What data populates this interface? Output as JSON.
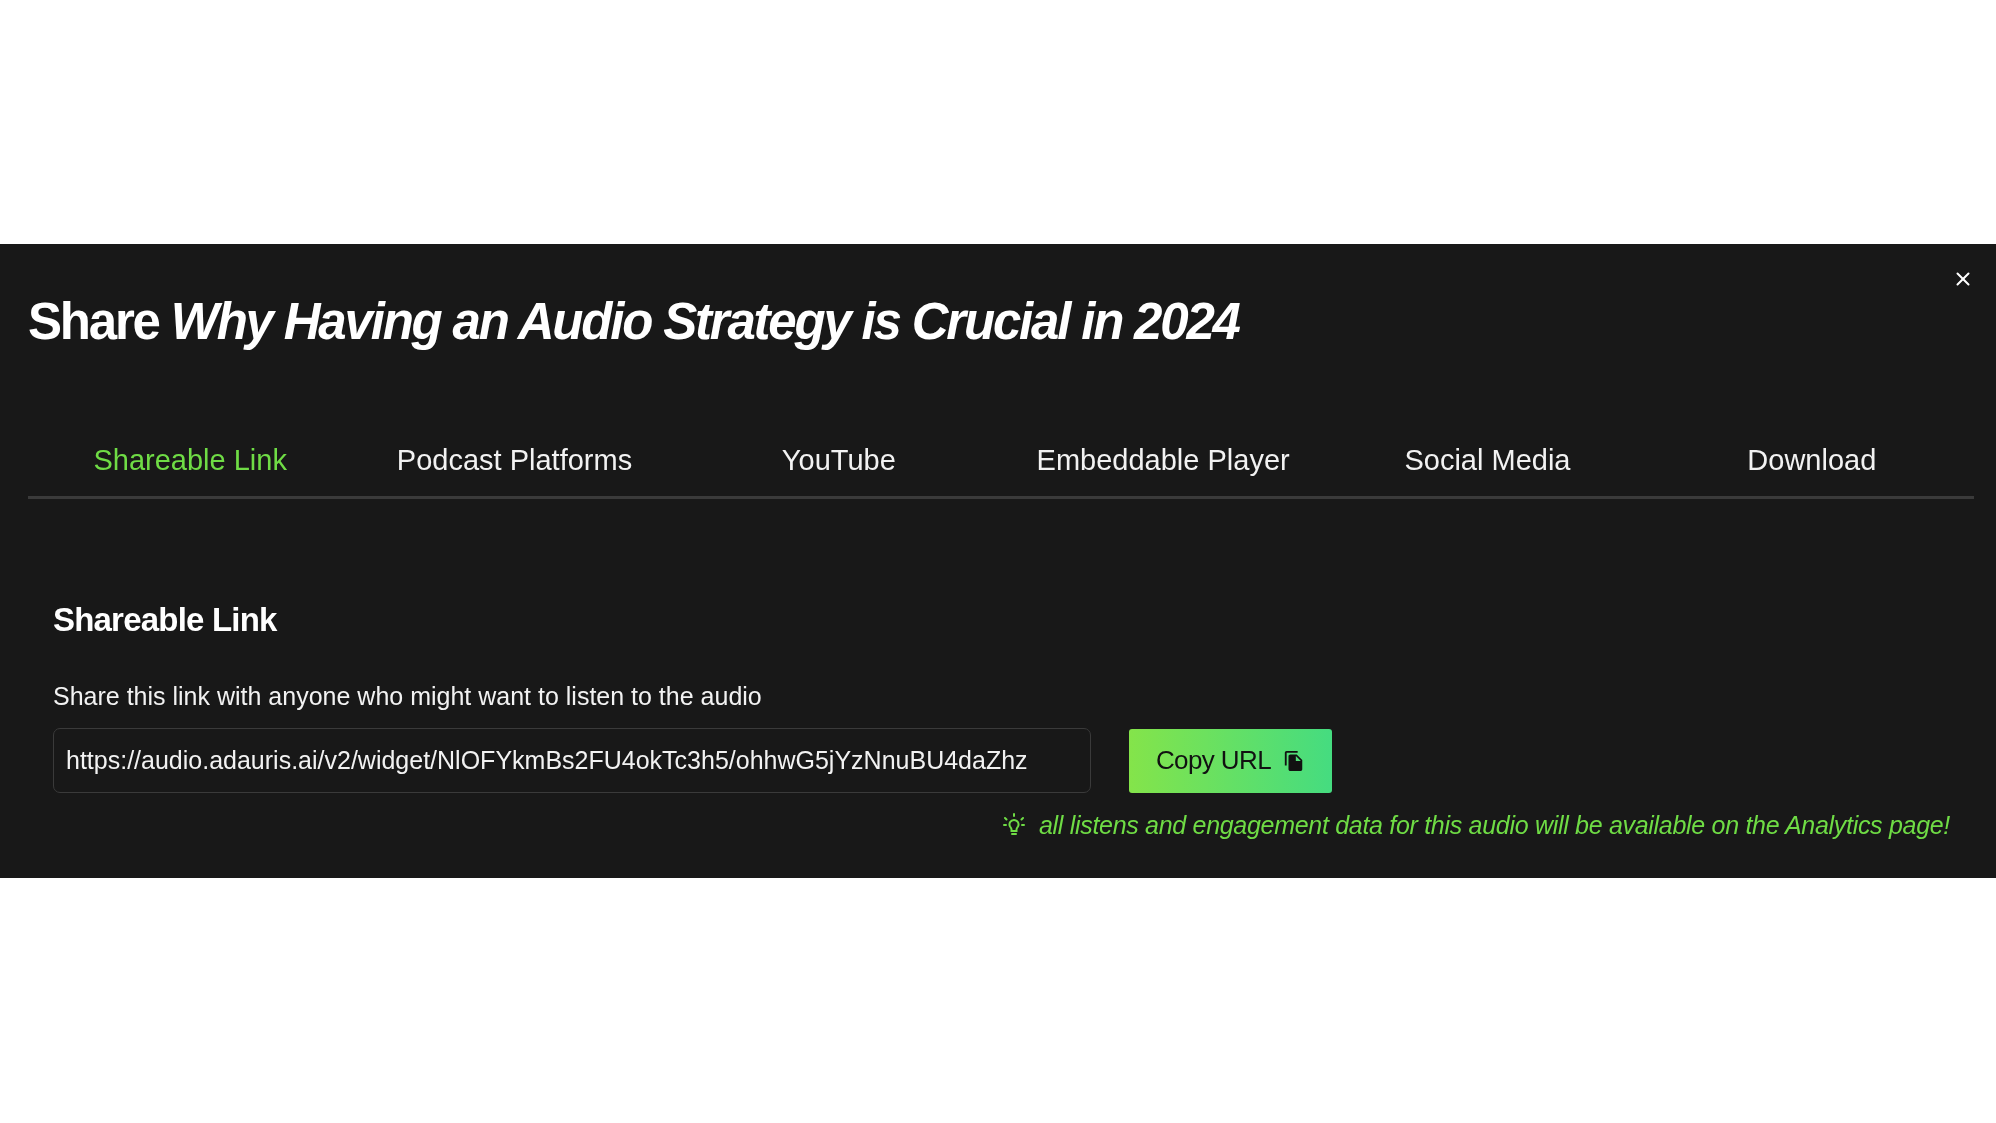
{
  "dialog": {
    "title": "Share *Why Having an Audio Strategy is Crucial in 2024*"
  },
  "tabs": [
    {
      "label": "Shareable Link",
      "selected": true
    },
    {
      "label": "Podcast Platforms",
      "selected": false
    },
    {
      "label": "YouTube",
      "selected": false
    },
    {
      "label": "Embeddable Player",
      "selected": false
    },
    {
      "label": "Social Media",
      "selected": false
    },
    {
      "label": "Download",
      "selected": false
    }
  ],
  "section": {
    "heading": "Shareable Link",
    "description": "Share this link with anyone who might want to listen to the audio",
    "link_field": {
      "value": "https://audio.adauris.ai/v2/widget/NlOFYkmBs2FU4okTc3h5/ohhwG5jYzNnuBU4daZhz"
    },
    "copy_button": {
      "label": "Copy URL"
    },
    "hint": "all listens and engagement data for this audio will be available on the Analytics page!"
  }
}
